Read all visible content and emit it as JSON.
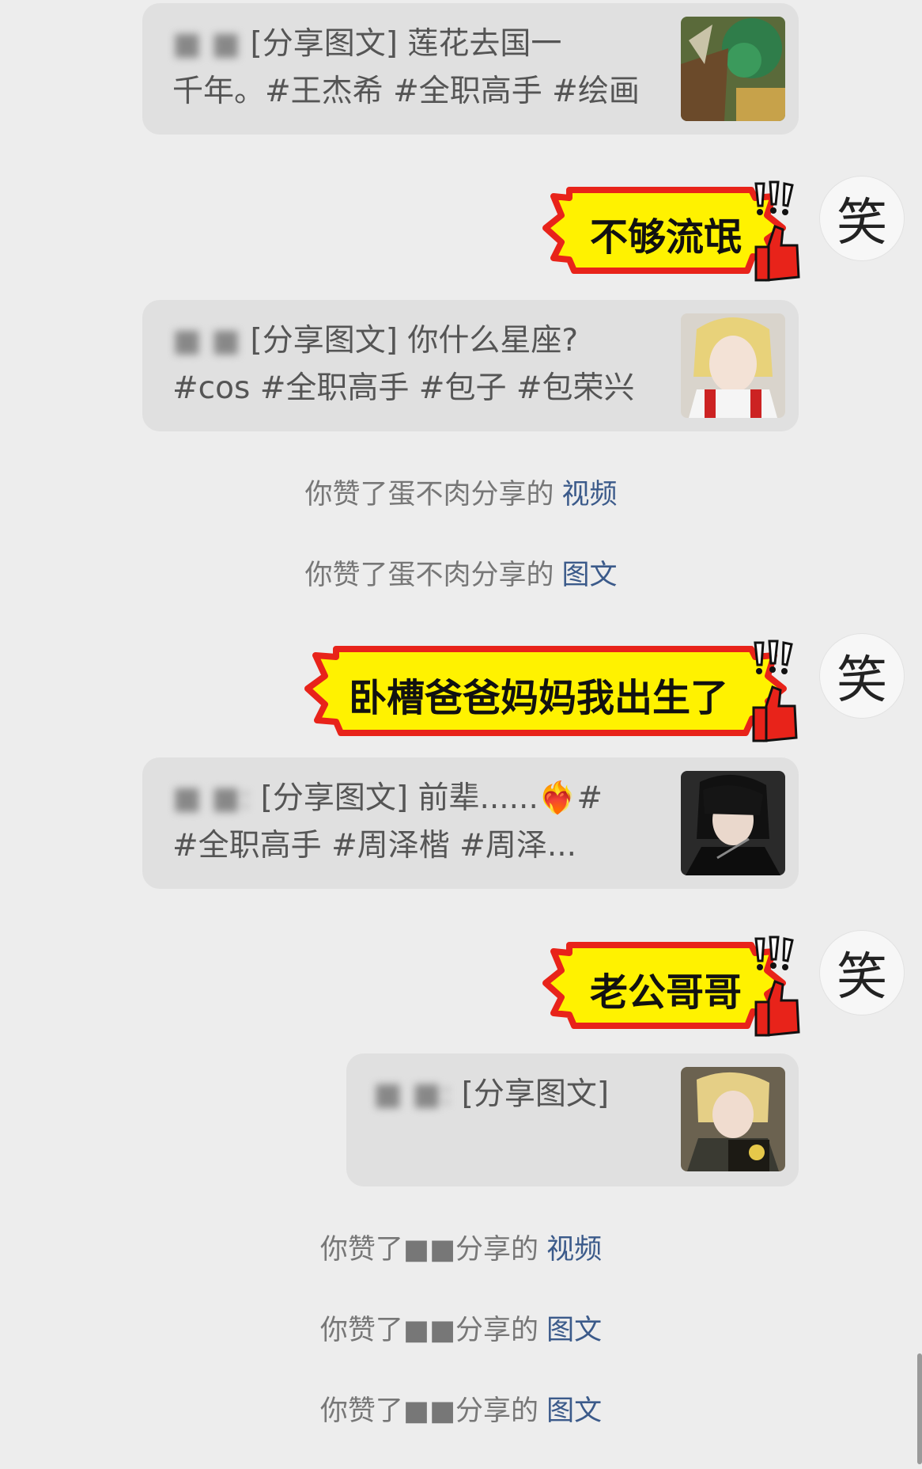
{
  "shares": [
    {
      "user": "■ ■",
      "text_line1": "[分享图文] 莲花去国一",
      "text_line2": "千年。#王杰希 #全职高手 #绘画"
    },
    {
      "user": "■ ■",
      "text_line1": "[分享图文] 你什么星座?",
      "text_line2": "#cos #全职高手 #包子  #包荣兴"
    },
    {
      "user": "■ ■:",
      "text_line1": "[分享图文] 前辈......❤️‍🔥#",
      "text_line2": "#全职高手 #周泽楷 #周泽..."
    },
    {
      "user": "■ ■:",
      "text_line1": "[分享图文]",
      "text_line2": ""
    }
  ],
  "stickers": [
    {
      "text": "不够流氓"
    },
    {
      "text": "卧槽爸爸妈妈我出生了"
    },
    {
      "text": "老公哥哥"
    }
  ],
  "avatar_char": "笑",
  "system_messages": [
    {
      "prefix": "你赞了蛋不肉分享的",
      "link": "视频"
    },
    {
      "prefix": "你赞了蛋不肉分享的",
      "link": "图文"
    },
    {
      "prefix": "你赞了■■分享的",
      "link": "视频"
    },
    {
      "prefix": "你赞了■■分享的",
      "link": "图文"
    },
    {
      "prefix": "你赞了■■分享的",
      "link": "图文"
    }
  ],
  "colors": {
    "sticker_fill": "#fff200",
    "sticker_stroke": "#e8231a",
    "link": "#3b5a8a"
  }
}
